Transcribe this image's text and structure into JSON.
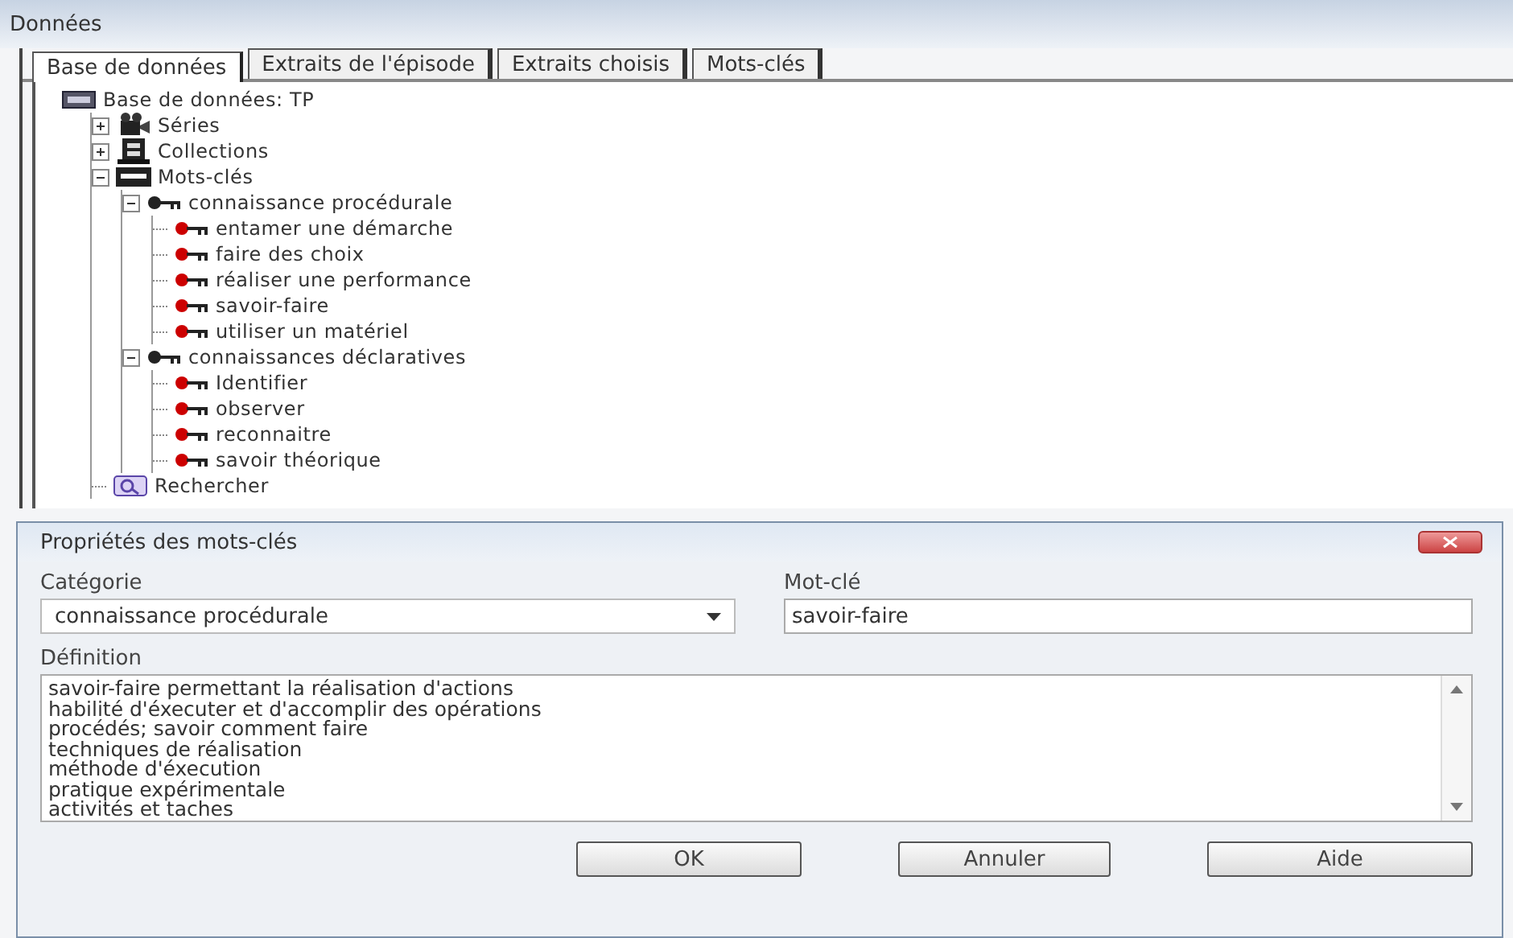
{
  "window": {
    "title": "Données"
  },
  "tabs": [
    {
      "label": "Base de données",
      "selected": true
    },
    {
      "label": "Extraits de l'épisode",
      "selected": false
    },
    {
      "label": "Extraits choisis",
      "selected": false
    },
    {
      "label": "Mots-clés",
      "selected": false
    }
  ],
  "tree": {
    "label": "Base de données: TP",
    "kind": "database",
    "children": [
      {
        "label": "Séries",
        "kind": "series",
        "expanded": false
      },
      {
        "label": "Collections",
        "kind": "collection",
        "expanded": false
      },
      {
        "label": "Mots-clés",
        "kind": "keywords",
        "expanded": true,
        "children": [
          {
            "label": "connaissance procédurale",
            "kind": "category",
            "expanded": true,
            "children": [
              {
                "label": "entamer une démarche",
                "kind": "keyword"
              },
              {
                "label": "faire des choix",
                "kind": "keyword"
              },
              {
                "label": "réaliser une performance",
                "kind": "keyword"
              },
              {
                "label": "savoir-faire",
                "kind": "keyword"
              },
              {
                "label": "utiliser un matériel",
                "kind": "keyword"
              }
            ]
          },
          {
            "label": "connaissances déclaratives",
            "kind": "category",
            "expanded": true,
            "children": [
              {
                "label": "Identifier",
                "kind": "keyword"
              },
              {
                "label": "observer",
                "kind": "keyword"
              },
              {
                "label": "reconnaitre",
                "kind": "keyword"
              },
              {
                "label": "savoir théorique",
                "kind": "keyword"
              }
            ]
          }
        ]
      },
      {
        "label": "Rechercher",
        "kind": "search"
      }
    ]
  },
  "dialog": {
    "title": "Propriétés des mots-clés",
    "category": {
      "label": "Catégorie",
      "value": "connaissance procédurale"
    },
    "keyword": {
      "label": "Mot-clé",
      "value": "savoir-faire"
    },
    "definition": {
      "label": "Définition",
      "lines": [
        "savoir-faire permettant la réalisation d'actions",
        "habilité d'éxecuter et d'accomplir des opérations",
        "procédés; savoir comment faire",
        "techniques de réalisation",
        "méthode d'éxecution",
        "pratique expérimentale",
        "activités et taches"
      ]
    },
    "buttons": [
      "OK",
      "Annuler",
      "Aide"
    ]
  }
}
